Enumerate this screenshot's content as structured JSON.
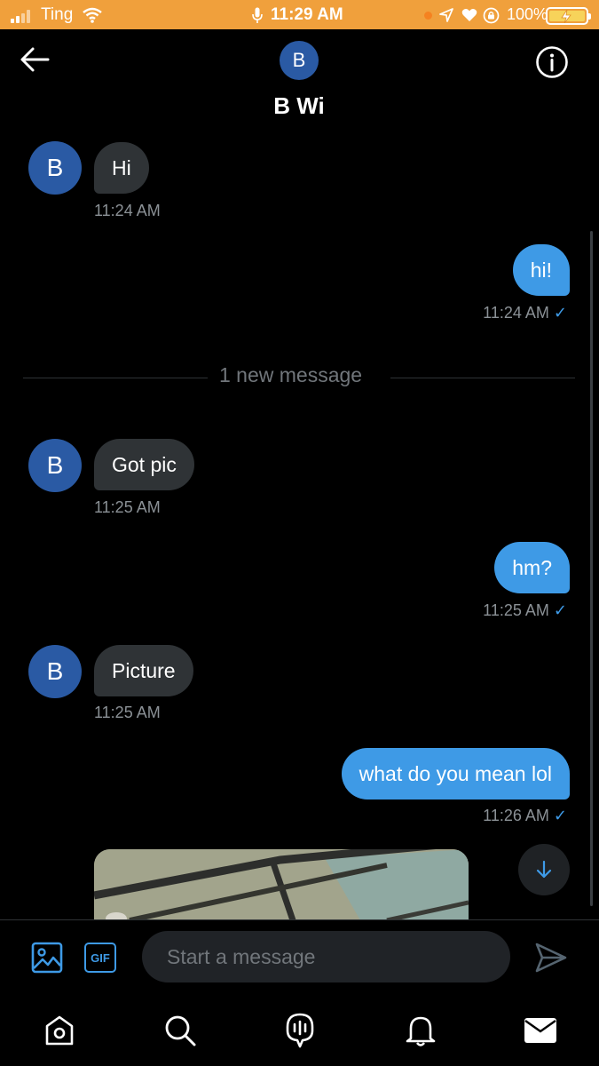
{
  "status_bar": {
    "carrier": "Ting",
    "time": "11:29 AM",
    "battery": "100%"
  },
  "header": {
    "avatar_letter": "B",
    "title": "B Wi"
  },
  "messages": [
    {
      "side": "received",
      "avatar_letter": "B",
      "text": "Hi",
      "time": "11:24 AM"
    },
    {
      "side": "sent",
      "text": "hi!",
      "time": "11:24 AM"
    },
    {
      "side": "received",
      "avatar_letter": "B",
      "text": "Got pic",
      "time": "11:25 AM"
    },
    {
      "side": "sent",
      "text": "hm?",
      "time": "11:25 AM"
    },
    {
      "side": "received",
      "avatar_letter": "B",
      "text": "Picture",
      "time": "11:25 AM"
    },
    {
      "side": "sent",
      "text": "what do you mean lol",
      "time": "11:26 AM"
    }
  ],
  "read_check": "✓",
  "divider_text": "1 new message",
  "composer": {
    "placeholder": "Start a message",
    "gif_label": "GIF"
  },
  "colors": {
    "status_bar": "#f0a03c",
    "accent": "#3e9ae6",
    "received_bubble": "#2f3336",
    "avatar": "#2a5aa4"
  }
}
